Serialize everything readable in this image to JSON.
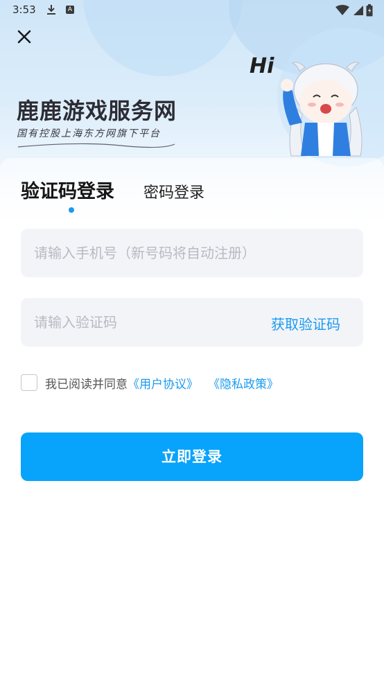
{
  "status_bar": {
    "time": "3:53",
    "download_icon": "download-icon",
    "notif_letter": "A",
    "icons": [
      "wifi-icon",
      "signal-icon",
      "battery-icon"
    ]
  },
  "header": {
    "close_icon": "close-icon",
    "brand_title": "鹿鹿游戏服务网",
    "brand_subtitle": "国有控股上海东方网旗下平台",
    "greeting": "Hi",
    "mascot_icon": "mascot-illustration"
  },
  "tabs": {
    "active": "验证码登录",
    "inactive": "密码登录"
  },
  "form": {
    "phone_placeholder": "请输入手机号（新号码将自动注册）",
    "phone_value": "",
    "code_placeholder": "请输入验证码",
    "code_value": "",
    "get_code_label": "获取验证码"
  },
  "agreement": {
    "checked": false,
    "prefix": "我已阅读并同意",
    "user_agreement": "《用户协议》",
    "privacy_policy": "《隐私政策》"
  },
  "login_button": "立即登录",
  "colors": {
    "accent": "#1a9af0",
    "button": "#08a3fb",
    "input_bg": "#f2f4f8",
    "hero_bg": "#cfe6f8"
  }
}
